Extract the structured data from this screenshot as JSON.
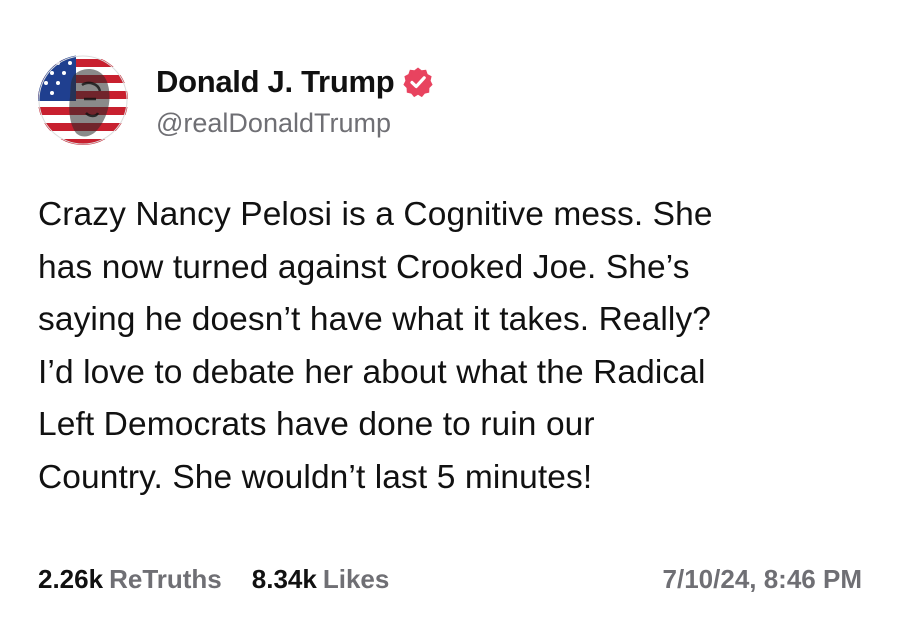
{
  "author": {
    "display_name": "Donald J. Trump",
    "handle": "@realDonaldTrump",
    "avatar_icon": "flag-portrait-avatar",
    "verified_icon": "verified-badge-icon"
  },
  "post": {
    "text": "Crazy Nancy Pelosi is a Cognitive mess. She\nhas now turned against Crooked Joe. She’s\nsaying he doesn’t have what it takes. Really?\nI’d love to debate her about what the Radical\nLeft Democrats have done to ruin our\nCountry. She wouldn’t last 5 minutes!"
  },
  "stats": {
    "retruths_count": "2.26k",
    "retruths_label": "ReTruths",
    "likes_count": "8.34k",
    "likes_label": "Likes"
  },
  "timestamp": "7/10/24, 8:46 PM",
  "colors": {
    "text": "#111111",
    "muted": "#6f6f74",
    "verified": "#e8435f",
    "background": "#ffffff"
  }
}
